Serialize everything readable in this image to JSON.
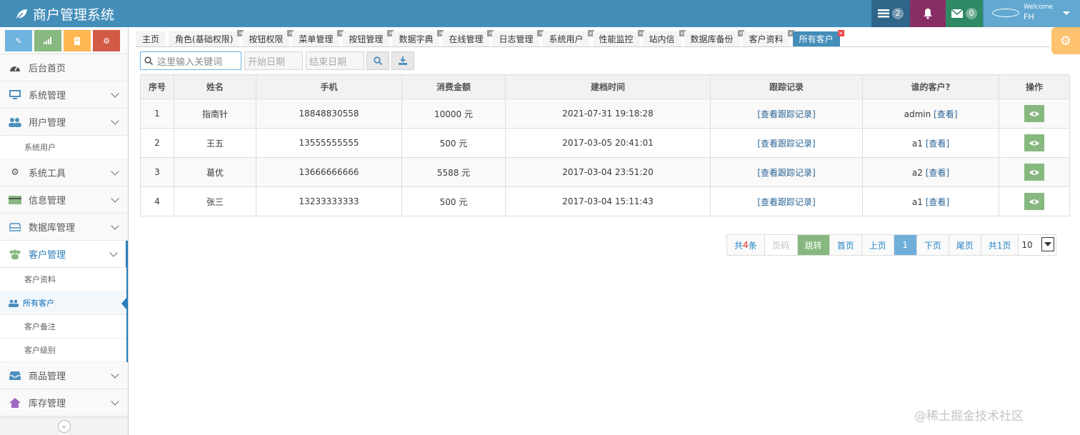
{
  "app": {
    "title": "商户管理系统"
  },
  "navbar": {
    "tasks_count": "2",
    "mail_count": "0",
    "welcome": "Welcome",
    "username": "FH"
  },
  "sidebar": {
    "menu": [
      {
        "label": "后台首页",
        "icon": "dashboard-icon"
      },
      {
        "label": "系统管理",
        "icon": "desktop-icon"
      },
      {
        "label": "用户管理",
        "icon": "users-icon"
      },
      {
        "label": "系统用户",
        "sub": true
      },
      {
        "label": "系统工具",
        "icon": "cog-icon"
      },
      {
        "label": "信息管理",
        "icon": "credit-card-icon"
      },
      {
        "label": "数据库管理",
        "icon": "hdd-icon"
      },
      {
        "label": "客户管理",
        "icon": "group-icon"
      },
      {
        "label": "客户资料",
        "sub": true
      },
      {
        "label": "所有客户",
        "sub": true,
        "active": true
      },
      {
        "label": "客户备注",
        "sub": true
      },
      {
        "label": "客户级别",
        "sub": true
      },
      {
        "label": "商品管理",
        "icon": "inbox-icon"
      },
      {
        "label": "库存管理",
        "icon": "home-icon"
      }
    ],
    "collapse": "«"
  },
  "tabs": [
    "主页",
    "角色(基础权限)",
    "按钮权限",
    "菜单管理",
    "按钮管理",
    "数据字典",
    "在线管理",
    "日志管理",
    "系统用户",
    "性能监控",
    "站内信",
    "数据库备份",
    "客户资料",
    "所有客户"
  ],
  "search": {
    "keyword_placeholder": "这里输入关键词",
    "start_placeholder": "开始日期",
    "end_placeholder": "结束日期"
  },
  "table": {
    "headers": [
      "序号",
      "姓名",
      "手机",
      "消费金额",
      "建档时间",
      "跟踪记录",
      "谁的客户?",
      "操作"
    ],
    "rows": [
      {
        "no": "1",
        "name": "指南针",
        "phone": "18848830558",
        "amount": "10000 元",
        "created": "2021-07-31 19:18:28",
        "track": "[查看跟踪记录]",
        "owner": "admin",
        "view": "[查看]"
      },
      {
        "no": "2",
        "name": "王五",
        "phone": "13555555555",
        "amount": "500 元",
        "created": "2017-03-05 20:41:01",
        "track": "[查看跟踪记录]",
        "owner": "a1",
        "view": "[查看]"
      },
      {
        "no": "3",
        "name": "葛优",
        "phone": "13666666666",
        "amount": "5588 元",
        "created": "2017-03-04 23:51:20",
        "track": "[查看跟踪记录]",
        "owner": "a2",
        "view": "[查看]"
      },
      {
        "no": "4",
        "name": "张三",
        "phone": "13233333333",
        "amount": "500 元",
        "created": "2017-03-04 15:11:43",
        "track": "[查看跟踪记录]",
        "owner": "a1",
        "view": "[查看]"
      }
    ]
  },
  "pager": {
    "total_prefix": "共",
    "total_count": "4",
    "total_suffix": "条",
    "page_input_placeholder": "页码",
    "go": "跳转",
    "first": "首页",
    "prev": "上页",
    "current": "1",
    "next": "下页",
    "last": "尾页",
    "pages": "共1页",
    "page_size": "10"
  },
  "watermark": "@稀土掘金技术社区",
  "colors": {
    "navbar": "#438eb9",
    "accent": "#2b7dbc",
    "green": "#87b87f"
  }
}
